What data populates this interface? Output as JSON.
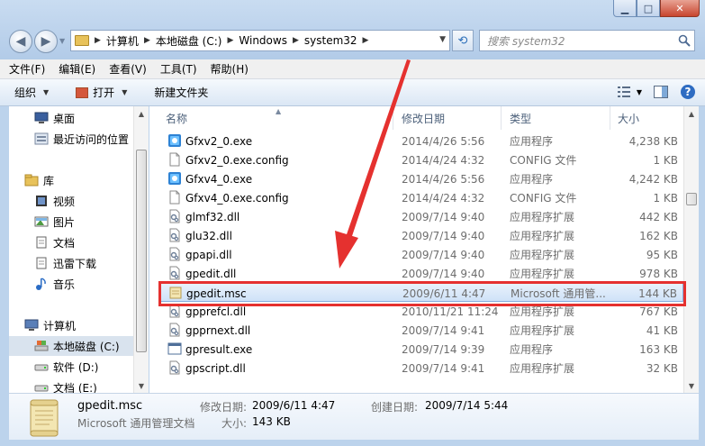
{
  "window": {
    "buttons": {
      "minimize": "▁",
      "maximize": "□",
      "close": "✕"
    }
  },
  "address": {
    "crumbs": [
      "计算机",
      "本地磁盘 (C:)",
      "Windows",
      "system32"
    ]
  },
  "search": {
    "placeholder": "搜索 system32"
  },
  "menu": [
    "文件(F)",
    "编辑(E)",
    "查看(V)",
    "工具(T)",
    "帮助(H)"
  ],
  "toolbar": {
    "organize": "组织",
    "open": "打开",
    "new_folder": "新建文件夹"
  },
  "nav": {
    "favorites": [
      "桌面",
      "最近访问的位置"
    ],
    "library_header": "库",
    "library": [
      "视频",
      "图片",
      "文档",
      "迅雷下载",
      "音乐"
    ],
    "computer_header": "计算机",
    "computer": [
      "本地磁盘 (C:)",
      "软件 (D:)",
      "文档 (E:)"
    ]
  },
  "columns": {
    "name": "名称",
    "date": "修改日期",
    "type": "类型",
    "size": "大小"
  },
  "files": [
    {
      "name": "Gfxv2_0.exe",
      "date": "2014/4/26 5:56",
      "type": "应用程序",
      "size": "4,238 KB",
      "icon": "exe"
    },
    {
      "name": "Gfxv2_0.exe.config",
      "date": "2014/4/24 4:32",
      "type": "CONFIG 文件",
      "size": "1 KB",
      "icon": "doc"
    },
    {
      "name": "Gfxv4_0.exe",
      "date": "2014/4/26 5:56",
      "type": "应用程序",
      "size": "4,242 KB",
      "icon": "exe"
    },
    {
      "name": "Gfxv4_0.exe.config",
      "date": "2014/4/24 4:32",
      "type": "CONFIG 文件",
      "size": "1 KB",
      "icon": "doc"
    },
    {
      "name": "glmf32.dll",
      "date": "2009/7/14 9:40",
      "type": "应用程序扩展",
      "size": "442 KB",
      "icon": "dll"
    },
    {
      "name": "glu32.dll",
      "date": "2009/7/14 9:40",
      "type": "应用程序扩展",
      "size": "162 KB",
      "icon": "dll"
    },
    {
      "name": "gpapi.dll",
      "date": "2009/7/14 9:40",
      "type": "应用程序扩展",
      "size": "95 KB",
      "icon": "dll"
    },
    {
      "name": "gpedit.dll",
      "date": "2009/7/14 9:40",
      "type": "应用程序扩展",
      "size": "978 KB",
      "icon": "dll"
    },
    {
      "name": "gpedit.msc",
      "date": "2009/6/11 4:47",
      "type": "Microsoft 通用管...",
      "size": "144 KB",
      "icon": "msc"
    },
    {
      "name": "gpprefcl.dll",
      "date": "2010/11/21 11:24",
      "type": "应用程序扩展",
      "size": "767 KB",
      "icon": "dll"
    },
    {
      "name": "gpprnext.dll",
      "date": "2009/7/14 9:41",
      "type": "应用程序扩展",
      "size": "41 KB",
      "icon": "dll"
    },
    {
      "name": "gpresult.exe",
      "date": "2009/7/14 9:39",
      "type": "应用程序",
      "size": "163 KB",
      "icon": "app"
    },
    {
      "name": "gpscript.dll",
      "date": "2009/7/14 9:41",
      "type": "应用程序扩展",
      "size": "32 KB",
      "icon": "dll"
    }
  ],
  "selected_index": 8,
  "details": {
    "filename": "gpedit.msc",
    "type": "Microsoft 通用管理文档",
    "modified_label": "修改日期:",
    "modified_value": "2009/6/11 4:47",
    "created_label": "创建日期:",
    "created_value": "2009/7/14 5:44",
    "size_label": "大小:",
    "size_value": "143 KB"
  },
  "colors": {
    "highlight_border": "#e5312f",
    "arrow": "#e5312f"
  }
}
